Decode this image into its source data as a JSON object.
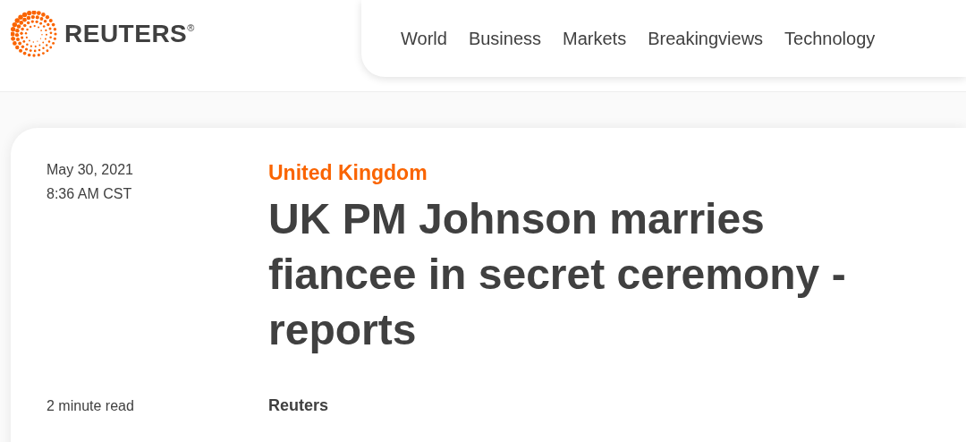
{
  "logo": {
    "wordmark": "REUTERS",
    "registered": "®"
  },
  "nav": [
    {
      "label": "World"
    },
    {
      "label": "Business"
    },
    {
      "label": "Markets"
    },
    {
      "label": "Breakingviews"
    },
    {
      "label": "Technology"
    }
  ],
  "article": {
    "date": "May 30, 2021",
    "time": "8:36 AM CST",
    "section": "United Kingdom",
    "headline": "UK PM Johnson marries fiancee in secret ceremony - reports",
    "read_time": "2 minute read",
    "byline": "Reuters"
  }
}
